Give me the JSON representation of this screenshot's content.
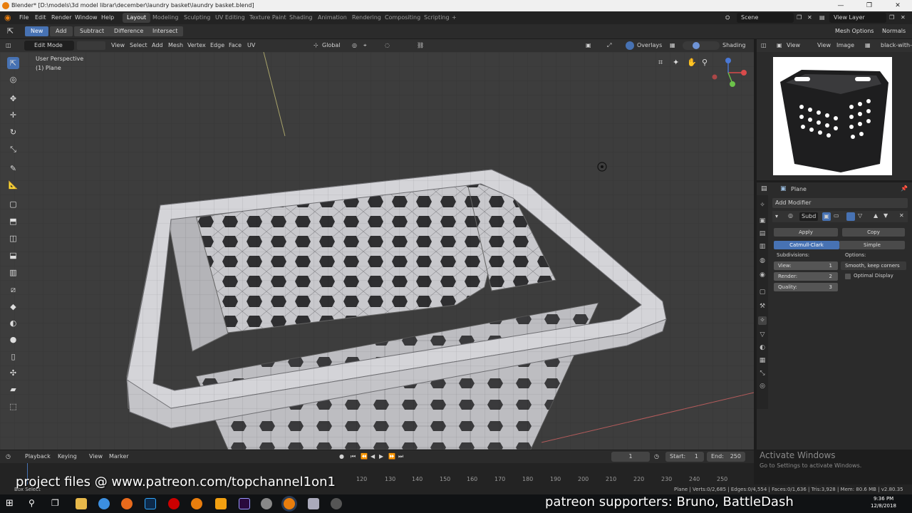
{
  "window": {
    "title": "Blender* [D:\\models\\3d model librar\\december\\laundry basket\\laundry basket.blend]",
    "controls": [
      "—",
      "❐",
      "✕"
    ]
  },
  "menu": {
    "items": [
      "File",
      "Edit",
      "Render",
      "Window",
      "Help"
    ]
  },
  "workspaces": [
    "Layout",
    "Modeling",
    "Sculpting",
    "UV Editing",
    "Texture Paint",
    "Shading",
    "Animation",
    "Rendering",
    "Compositing",
    "Scripting",
    "+"
  ],
  "scene": {
    "label": "Scene",
    "view_layer": "View Layer"
  },
  "tool_header": {
    "buttons": [
      "New",
      "Add",
      "Subtract",
      "Difference",
      "Intersect"
    ],
    "mesh_options": "Mesh Options",
    "normals": "Normals"
  },
  "viewport_header": {
    "mode": "Edit Mode",
    "menus": [
      "View",
      "Select",
      "Add",
      "Mesh",
      "Vertex",
      "Edge",
      "Face",
      "UV"
    ],
    "orientation": "Global",
    "overlays": "Overlays",
    "shading": "Shading"
  },
  "viewport": {
    "view_name": "User Perspective",
    "object_name": "(1) Plane"
  },
  "image_editor": {
    "menus": [
      "View",
      "View",
      "Image"
    ],
    "image_name": "black-with-si"
  },
  "properties": {
    "object_name": "Plane",
    "add_modifier": "Add Modifier",
    "modifier_name": "Subd",
    "apply": "Apply",
    "copy": "Copy",
    "tabs": [
      "Catmull-Clark",
      "Simple"
    ],
    "subdivisions_label": "Subdivisions:",
    "options_label": "Options:",
    "view_label": "View:",
    "view_value": "1",
    "render_label": "Render:",
    "render_value": "2",
    "quality_label": "Quality:",
    "quality_value": "3",
    "smooth_option": "Smooth, keep corners",
    "optimal_display": "Optimal Display"
  },
  "timeline": {
    "menus": [
      "Playback",
      "Keying",
      "View",
      "Marker"
    ],
    "current_frame": "1",
    "start_label": "Start:",
    "start_value": "1",
    "end_label": "End:",
    "end_value": "250",
    "ticks": [
      "120",
      "130",
      "140",
      "150",
      "160",
      "170",
      "180",
      "190",
      "200",
      "210",
      "220",
      "230",
      "240",
      "250"
    ]
  },
  "status": {
    "left": "Box Select",
    "stats": "Plane | Verts:0/2,685 | Edges:0/4,554 | Faces:0/1,636 | Tris:3,928 | Mem: 80.6 MB | v2.80.35"
  },
  "watermark": {
    "title": "Activate Windows",
    "subtitle": "Go to Settings to activate Windows."
  },
  "overlay": {
    "patreon_left": "project files @ www.patreon.com/topchannel1on1",
    "patreon_right": "patreon supporters: Bruno, BattleDash"
  },
  "taskbar": {
    "time": "9:36 PM",
    "date": "12/8/2018"
  },
  "colors": {
    "accent": "#4772b3",
    "header": "#303030",
    "viewport": "#3d3d3d",
    "orange": "#e87d0d"
  }
}
